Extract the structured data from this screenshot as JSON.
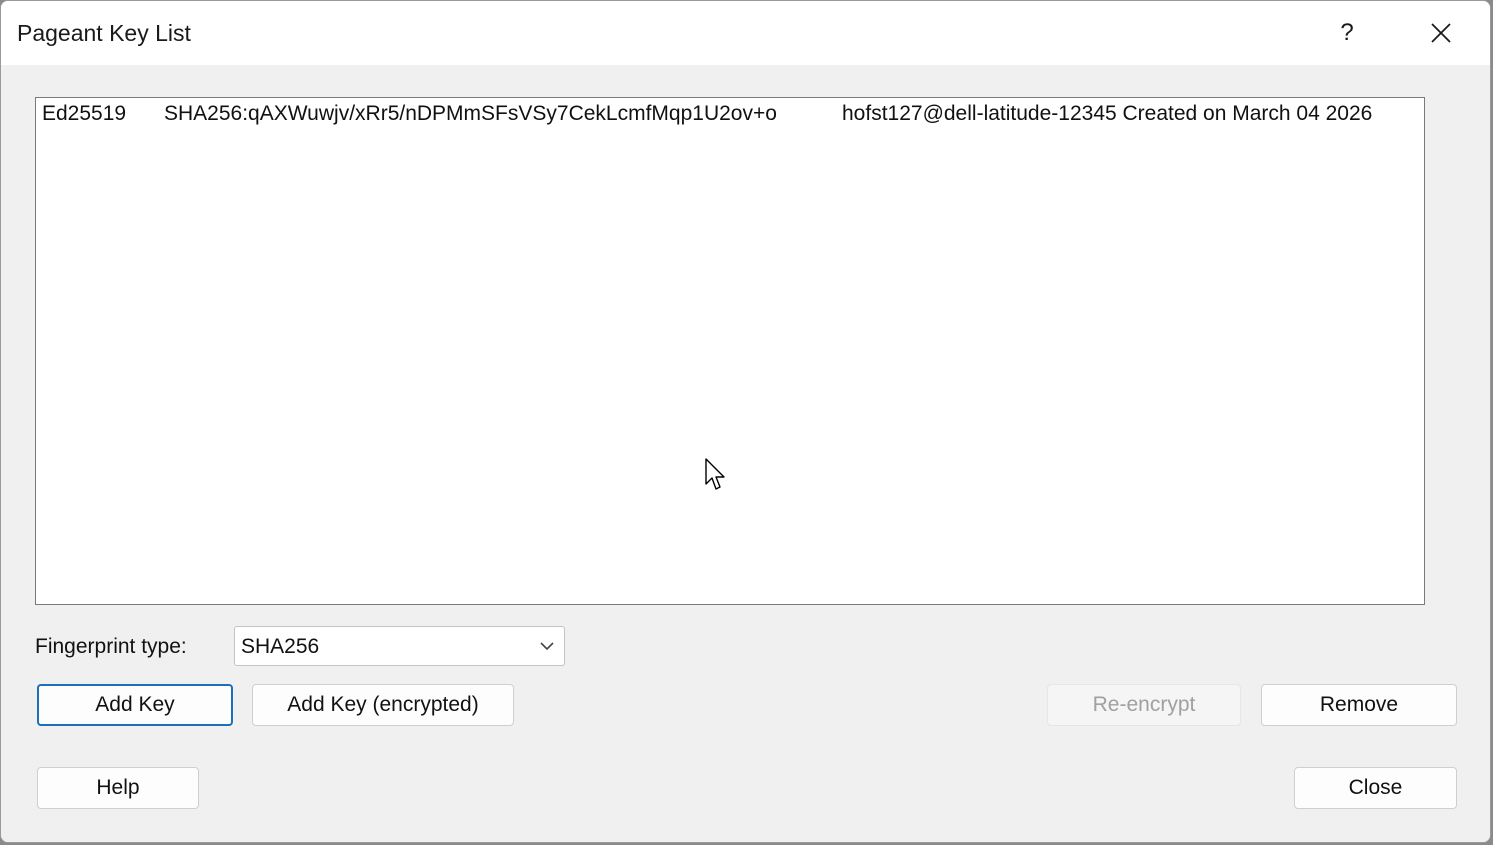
{
  "window": {
    "title": "Pageant Key List",
    "help_glyph": "?",
    "close_glyph": "✕"
  },
  "key_list": {
    "rows": [
      {
        "type": "Ed25519",
        "fingerprint": "SHA256:qAXWuwjv/xRr5/nDPMmSFsVSy7CekLcmfMqp1U2ov+o",
        "comment": "hofst127@dell-latitude-12345 Created on March 04 2026"
      }
    ]
  },
  "fingerprint_type": {
    "label": "Fingerprint type:",
    "selected": "SHA256"
  },
  "buttons": {
    "add_key": "Add Key",
    "add_key_encrypted": "Add Key (encrypted)",
    "re_encrypt": "Re-encrypt",
    "remove": "Remove",
    "help": "Help",
    "close": "Close"
  },
  "icons": {
    "chevron": "chevron-down-icon",
    "close": "close-icon",
    "cursor": "mouse-pointer-icon"
  },
  "colors": {
    "default_button_border": "#1f6fb8",
    "window_bg": "#f0f0f0"
  }
}
